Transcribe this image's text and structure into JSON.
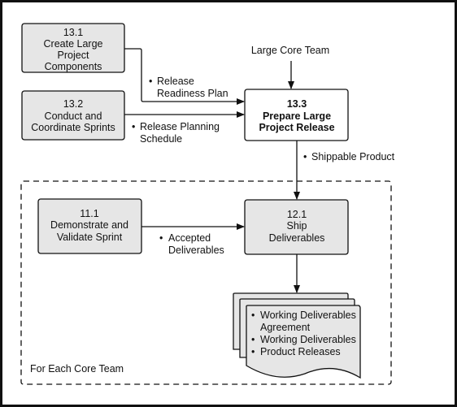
{
  "processes": {
    "p13_1": {
      "id": "13.1",
      "lines": [
        "Create Large",
        "Project",
        "Components"
      ]
    },
    "p13_2": {
      "id": "13.2",
      "lines": [
        "Conduct and",
        "Coordinate Sprints"
      ]
    },
    "p13_3": {
      "id": "13.3",
      "lines": [
        "Prepare Large",
        "Project Release"
      ]
    },
    "p11_1": {
      "id": "11.1",
      "lines": [
        "Demonstrate and",
        "Validate Sprint"
      ]
    },
    "p12_1": {
      "id": "12.1",
      "lines": [
        "Ship",
        "Deliverables"
      ]
    }
  },
  "inputs": {
    "large_core_team": "Large Core Team"
  },
  "flows": {
    "release_readiness": [
      "Release",
      "Readiness Plan"
    ],
    "release_planning": [
      "Release Planning",
      "Schedule"
    ],
    "shippable_product": "Shippable Product",
    "accepted_deliverables": [
      "Accepted",
      "Deliverables"
    ]
  },
  "outputs": {
    "items": [
      "Working Deliverables",
      "Agreement",
      "Working Deliverables",
      "Product Releases"
    ]
  },
  "group_label": "For Each Core Team",
  "bullet": "•"
}
